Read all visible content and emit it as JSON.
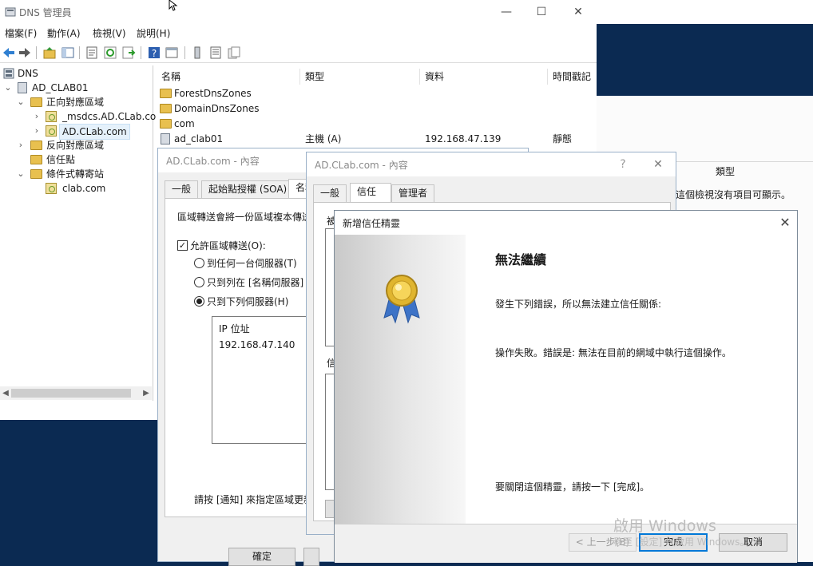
{
  "dns_manager": {
    "title": "DNS 管理員",
    "controls": {
      "minimize": "—",
      "maximize": "☐",
      "close": "✕"
    },
    "menu": [
      "檔案(F)",
      "動作(A)",
      "檢視(V)",
      "說明(H)"
    ],
    "tree": {
      "root": "DNS",
      "server": "AD_CLAB01",
      "forward_zones": "正向對應區域",
      "msdcs_zone": "_msdcs.AD.CLab.com",
      "ad_zone": "AD.CLab.com",
      "reverse_zones": "反向對應區域",
      "trust_points": "信任點",
      "conditional_forwarders": "條件式轉寄站",
      "clab_zone": "clab.com"
    },
    "list": {
      "columns": [
        "名稱",
        "類型",
        "資料",
        "時間戳記"
      ],
      "rows": [
        {
          "name": "ForestDnsZones",
          "type": "",
          "data": "",
          "timestamp": ""
        },
        {
          "name": "DomainDnsZones",
          "type": "",
          "data": "",
          "timestamp": ""
        },
        {
          "name": "com",
          "type": "",
          "data": "",
          "timestamp": ""
        },
        {
          "name": "ad_clab01",
          "type": "主機 (A)",
          "data": "192.168.47.139",
          "timestamp": "靜態"
        }
      ]
    },
    "right_background": {
      "column_type": "類型",
      "empty_text": "這個檢視沒有項目可顯示。"
    }
  },
  "zone_props": {
    "title": "AD.CLab.com - 內容",
    "tabs": [
      "一般",
      "起始點授權 (SOA)",
      "名稱"
    ],
    "description": "區域轉送會將一份區域複本傳送",
    "allow_transfer": "允許區域轉送(O):",
    "option_any": "到任何一台伺服器(T)",
    "option_ns": "只到列在 [名稱伺服器] 索",
    "option_list": "只到下列伺服器(H)",
    "ip_header": "IP 位址",
    "ip_value": "192.168.47.140",
    "notify_text": "請按 [通知] 來指定區域更新",
    "ok_button": "確定"
  },
  "domain_props": {
    "title": "AD.CLab.com - 內容",
    "help": "?",
    "close": "✕",
    "tabs": [
      "一般",
      "信任",
      "管理者"
    ],
    "label_trusted_by": "被",
    "label_trusts": "信"
  },
  "wizard": {
    "title": "新增信任精靈",
    "close": "✕",
    "heading": "無法繼續",
    "message1": "發生下列錯誤，所以無法建立信任關係:",
    "message2": "操作失敗。錯誤是: 無法在目前的網域中執行這個操作。",
    "message3": "要關閉這個精靈，請按一下 [完成]。",
    "back_button": "< 上一步(B)",
    "finish_button": "完成",
    "cancel_button": "取消"
  },
  "watermark": {
    "line1": "啟用 Windows",
    "line2": "移至 [設定] 以啟用 Windows。"
  },
  "colors": {
    "accent": "#0078d7",
    "folder": "#e8c04f",
    "desktop": "#0b2a52"
  }
}
